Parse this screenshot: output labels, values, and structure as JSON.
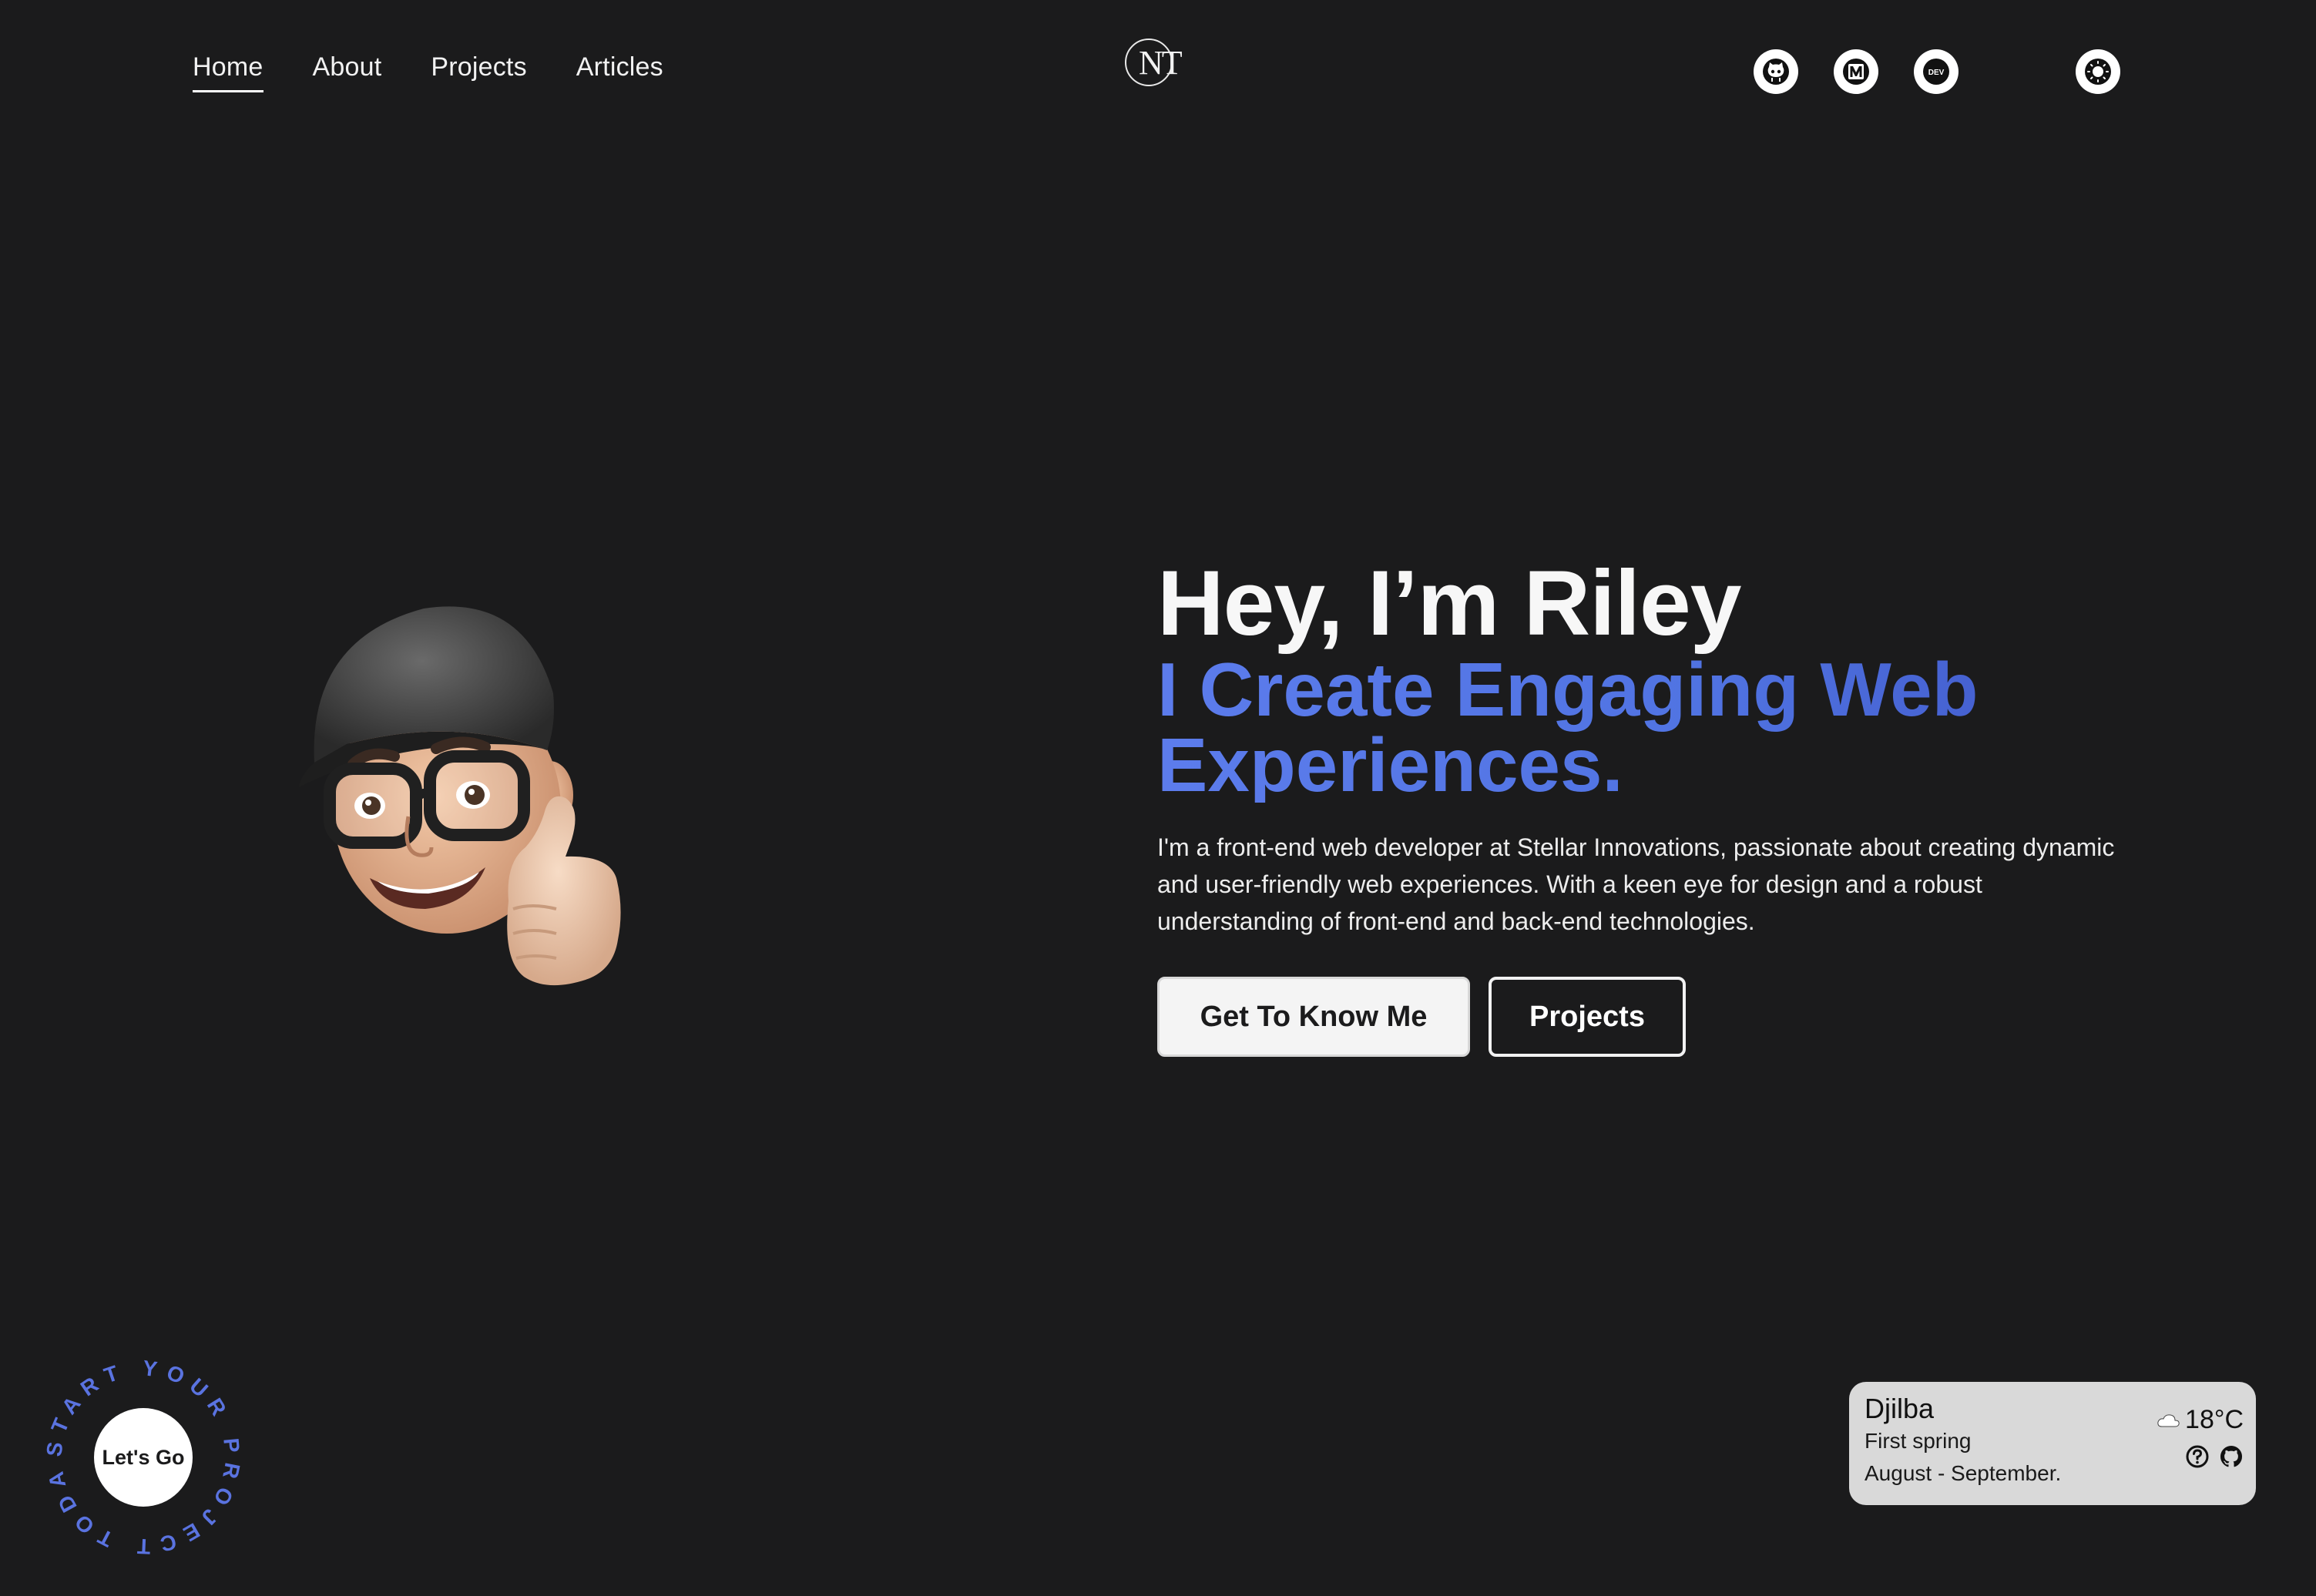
{
  "nav": {
    "links": [
      {
        "label": "Home"
      },
      {
        "label": "About"
      },
      {
        "label": "Projects"
      },
      {
        "label": "Articles"
      }
    ],
    "logo_text": "NT"
  },
  "social": {
    "icons": [
      "github-icon",
      "medium-icon",
      "dev-icon"
    ],
    "dev_label": "DEV"
  },
  "theme_toggle_icon": "sun-icon",
  "hero": {
    "title": "Hey, I’m Riley",
    "subtitle": "I Create Engaging Web Experiences.",
    "description": "I'm a front-end web developer at Stellar Innovations, passionate about creating dynamic and user-friendly web experiences. With a keen eye for design and a robust understanding of front-end and back-end technologies.",
    "primary_button": "Get To Know Me",
    "secondary_button": "Projects"
  },
  "cta": {
    "ring_text": "START YOUR PROJECT TODAY ",
    "button_label": "Let's Go"
  },
  "season": {
    "name": "Djilba",
    "subtitle": "First spring",
    "months": "August - September.",
    "temperature": "18°C"
  },
  "colors": {
    "background": "#1b1b1c",
    "accent": "#5073e2",
    "widget_bg": "#d9d9d9"
  }
}
